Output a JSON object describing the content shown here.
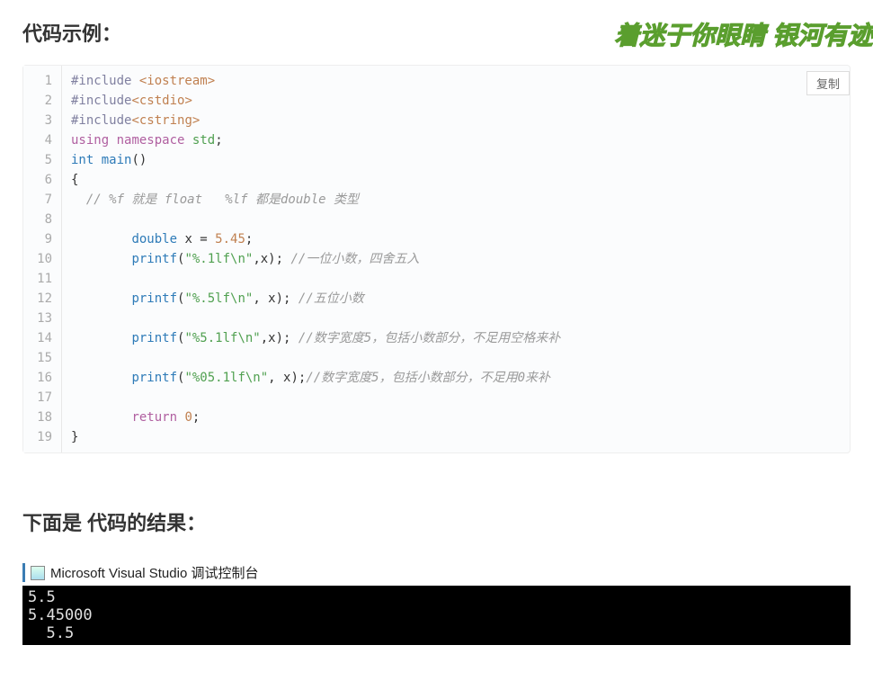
{
  "watermark": "着迷于你眼睛 银河有迹",
  "heading1": "代码示例：",
  "copy_label": "复制",
  "code_lines": [
    [
      {
        "t": "preproc",
        "v": "#include "
      },
      {
        "t": "str",
        "v": "<iostream>"
      }
    ],
    [
      {
        "t": "preproc",
        "v": "#include"
      },
      {
        "t": "str",
        "v": "<cstdio>"
      }
    ],
    [
      {
        "t": "preproc",
        "v": "#include"
      },
      {
        "t": "str",
        "v": "<cstring>"
      }
    ],
    [
      {
        "t": "kw2",
        "v": "using"
      },
      {
        "t": "plain",
        "v": " "
      },
      {
        "t": "kw2",
        "v": "namespace"
      },
      {
        "t": "plain",
        "v": " "
      },
      {
        "t": "ns",
        "v": "std"
      },
      {
        "t": "plain",
        "v": ";"
      }
    ],
    [
      {
        "t": "kw",
        "v": "int"
      },
      {
        "t": "plain",
        "v": " "
      },
      {
        "t": "id",
        "v": "main"
      },
      {
        "t": "plain",
        "v": "()"
      }
    ],
    [
      {
        "t": "plain",
        "v": "{"
      }
    ],
    [
      {
        "t": "plain",
        "v": "  "
      },
      {
        "t": "cmt",
        "v": "// %f 就是 float   %lf 都是double 类型"
      }
    ],
    [],
    [
      {
        "t": "plain",
        "v": "        "
      },
      {
        "t": "kw",
        "v": "double"
      },
      {
        "t": "plain",
        "v": " x = "
      },
      {
        "t": "num",
        "v": "5.45"
      },
      {
        "t": "plain",
        "v": ";"
      }
    ],
    [
      {
        "t": "plain",
        "v": "        "
      },
      {
        "t": "id",
        "v": "printf"
      },
      {
        "t": "plain",
        "v": "("
      },
      {
        "t": "strlit",
        "v": "\"%.1lf\\n\""
      },
      {
        "t": "plain",
        "v": ",x); "
      },
      {
        "t": "cmt",
        "v": "//一位小数，四舍五入"
      }
    ],
    [],
    [
      {
        "t": "plain",
        "v": "        "
      },
      {
        "t": "id",
        "v": "printf"
      },
      {
        "t": "plain",
        "v": "("
      },
      {
        "t": "strlit",
        "v": "\"%.5lf\\n\""
      },
      {
        "t": "plain",
        "v": ", x); "
      },
      {
        "t": "cmt",
        "v": "//五位小数"
      }
    ],
    [],
    [
      {
        "t": "plain",
        "v": "        "
      },
      {
        "t": "id",
        "v": "printf"
      },
      {
        "t": "plain",
        "v": "("
      },
      {
        "t": "strlit",
        "v": "\"%5.1lf\\n\""
      },
      {
        "t": "plain",
        "v": ",x); "
      },
      {
        "t": "cmt",
        "v": "//数字宽度5，包括小数部分，不足用空格来补"
      }
    ],
    [],
    [
      {
        "t": "plain",
        "v": "        "
      },
      {
        "t": "id",
        "v": "printf"
      },
      {
        "t": "plain",
        "v": "("
      },
      {
        "t": "strlit",
        "v": "\"%05.1lf\\n\""
      },
      {
        "t": "plain",
        "v": ", x);"
      },
      {
        "t": "cmt",
        "v": "//数字宽度5，包括小数部分，不足用0来补"
      }
    ],
    [],
    [
      {
        "t": "plain",
        "v": "        "
      },
      {
        "t": "kw2",
        "v": "return"
      },
      {
        "t": "plain",
        "v": " "
      },
      {
        "t": "num",
        "v": "0"
      },
      {
        "t": "plain",
        "v": ";"
      }
    ],
    [
      {
        "t": "plain",
        "v": "}"
      }
    ]
  ],
  "heading2": "下面是 代码的结果：",
  "console": {
    "title": "Microsoft Visual Studio 调试控制台",
    "output": "5.5\n5.45000\n  5.5"
  }
}
